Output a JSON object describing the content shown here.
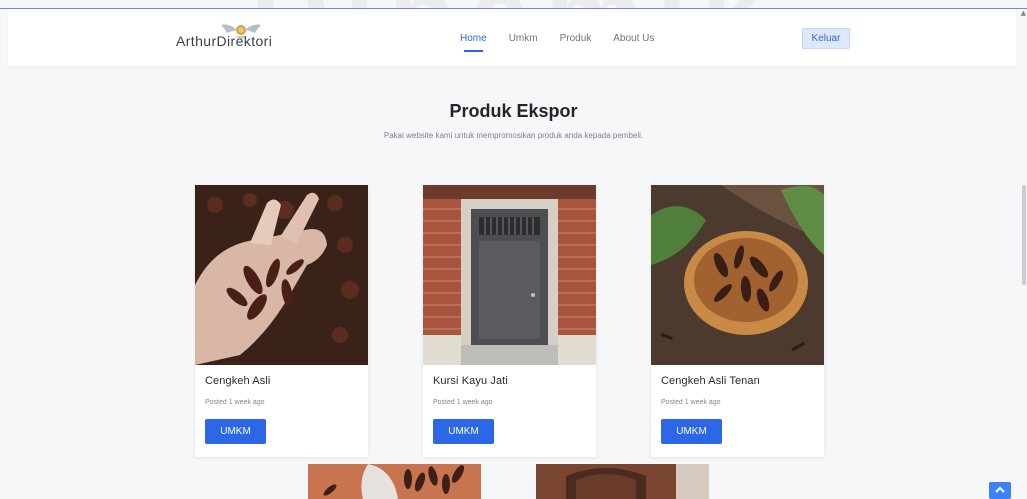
{
  "header": {
    "brand": "ArthurDirektori",
    "watermark": "Dinamik",
    "nav": [
      {
        "label": "Home",
        "active": true
      },
      {
        "label": "Umkm",
        "active": false
      },
      {
        "label": "Produk",
        "active": false
      },
      {
        "label": "About Us",
        "active": false
      }
    ],
    "logout_label": "Keluar"
  },
  "hero": {
    "title": "Produk Ekspor",
    "subtitle": "Pakai website kami untuk mempromosikan produk anda kepada pembeli."
  },
  "products": [
    {
      "title": "Cengkeh Asli",
      "meta": "Posted 1 week ago",
      "button": "UMKM",
      "image": "cloves-in-hand"
    },
    {
      "title": "Kursi Kayu Jati",
      "meta": "Posted 1 week ago",
      "button": "UMKM",
      "image": "wooden-door"
    },
    {
      "title": "Cengkeh Asli Tenan",
      "meta": "Posted 1 week ago",
      "button": "UMKM",
      "image": "cloves-in-spoon"
    }
  ],
  "colors": {
    "accent": "#2b67e6",
    "page_bg": "#f6f7f9",
    "nav_active": "#2f64d6"
  },
  "icons": {
    "scroll_top": "chevron-up-icon",
    "scroll_up": "caret-up-icon"
  }
}
